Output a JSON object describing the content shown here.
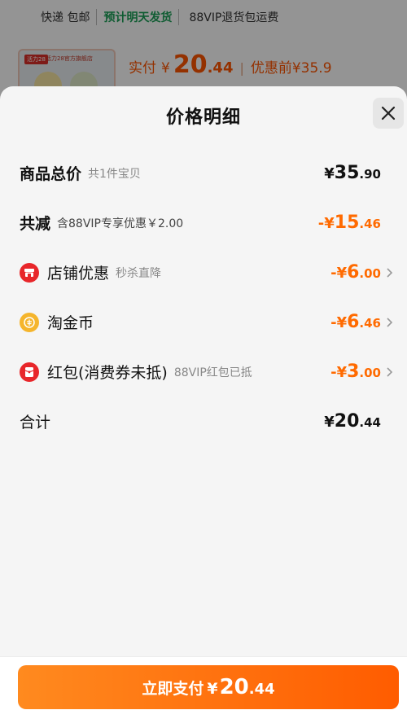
{
  "background": {
    "shipping": "快递 包邮",
    "delivery_promise": "预计明天发货",
    "vip_note": "88VIP退货包运费",
    "thumb_tag": "活力28",
    "thumb_title": "活力28官方旗舰店",
    "paid_label": "实付",
    "currency": "¥",
    "paid_main": "20",
    "paid_dec": ".44",
    "separator": "|",
    "before_label": "优惠前",
    "before_value": "¥35.9"
  },
  "sheet": {
    "title": "价格明细",
    "close_icon": "close-icon"
  },
  "rows": {
    "total": {
      "label": "商品总价",
      "sub": "共1件宝贝",
      "currency": "¥",
      "main": "35",
      "dec": ".90"
    },
    "discount": {
      "label": "共减",
      "sub": "含88VIP专享优惠￥2.00",
      "currency": "-¥",
      "main": "15",
      "dec": ".46"
    },
    "shop": {
      "label": "店铺优惠",
      "sub": "秒杀直降",
      "icon": "shop-icon",
      "currency": "-¥",
      "main": "6",
      "dec": ".00"
    },
    "coin": {
      "label": "淘金币",
      "icon": "coin-icon",
      "currency": "-¥",
      "main": "6",
      "dec": ".46"
    },
    "redpacket": {
      "label": "红包(消费券未抵)",
      "sub": "88VIP红包已抵",
      "icon": "red-packet-icon",
      "currency": "-¥",
      "main": "3",
      "dec": ".00"
    },
    "sum": {
      "label": "合计",
      "currency": "¥",
      "main": "20",
      "dec": ".44"
    }
  },
  "pay_button": {
    "label": "立即支付",
    "currency": "¥",
    "main": "20",
    "dec": ".44"
  },
  "colors": {
    "accent": "#ff6a00",
    "button_start": "#ff8a1f",
    "button_end": "#ff5c00",
    "green": "#1a9f56",
    "red_icon": "#e8262a",
    "coin_icon": "#f5b52c"
  }
}
